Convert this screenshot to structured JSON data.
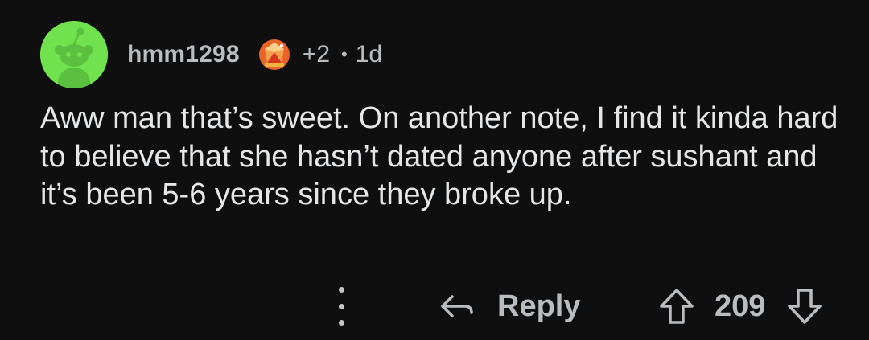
{
  "comment": {
    "username": "hmm1298",
    "award_count": "+2",
    "separator": "•",
    "time_ago": "1d",
    "body": "Aww man that’s sweet. On another note, I find it kinda hard to believe that she hasn’t dated anyone after sushant and it’s been 5-6 years since they broke up.",
    "avatar_icon": "snoo-avatar-icon",
    "award_icon": "gem-award-icon"
  },
  "actions": {
    "more_icon": "more-vertical-icon",
    "reply_icon": "reply-arrow-icon",
    "reply_label": "Reply",
    "upvote_icon": "upvote-arrow-icon",
    "vote_count": "209",
    "downvote_icon": "downvote-arrow-icon"
  },
  "colors": {
    "background": "#0f0f0f",
    "avatar_bg": "#6fe24e",
    "text": "#e4e6e8",
    "muted": "#b9bdc0"
  }
}
